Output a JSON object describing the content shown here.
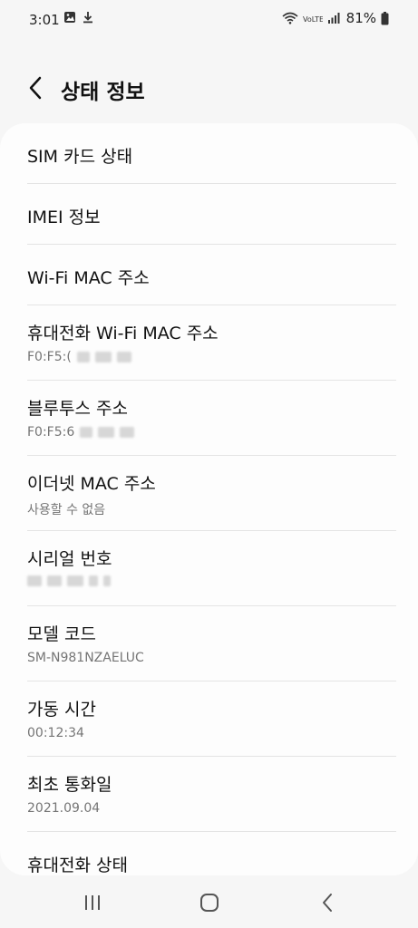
{
  "status_bar": {
    "time": "3:01",
    "network_label": "Wi-Fi",
    "battery": "81%"
  },
  "header": {
    "title": "상태 정보"
  },
  "items": [
    {
      "title": "SIM 카드 상태"
    },
    {
      "title": "IMEI 정보"
    },
    {
      "title": "Wi-Fi MAC 주소"
    },
    {
      "title": "휴대전화 Wi-Fi MAC 주소",
      "subtitle": "F0:F5:("
    },
    {
      "title": "블루투스 주소",
      "subtitle": "F0:F5:6"
    },
    {
      "title": "이더넷 MAC 주소",
      "subtitle": "사용할 수 없음"
    },
    {
      "title": "시리얼 번호",
      "subtitle": ""
    },
    {
      "title": "모델 코드",
      "subtitle": "SM-N981NZAELUC"
    },
    {
      "title": "가동 시간",
      "subtitle": "00:12:34"
    },
    {
      "title": "최초 통화일",
      "subtitle": "2021.09.04"
    },
    {
      "title": "휴대전화 상태"
    }
  ],
  "nav": {
    "recents": "recents-icon",
    "home": "home-icon",
    "back": "back-icon"
  }
}
